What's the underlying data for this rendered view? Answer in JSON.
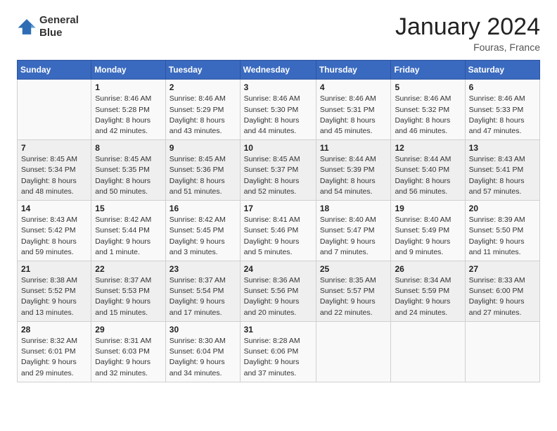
{
  "header": {
    "logo_line1": "General",
    "logo_line2": "Blue",
    "title": "January 2024",
    "subtitle": "Fouras, France"
  },
  "weekdays": [
    "Sunday",
    "Monday",
    "Tuesday",
    "Wednesday",
    "Thursday",
    "Friday",
    "Saturday"
  ],
  "weeks": [
    [
      {
        "num": "",
        "detail": ""
      },
      {
        "num": "1",
        "detail": "Sunrise: 8:46 AM\nSunset: 5:28 PM\nDaylight: 8 hours\nand 42 minutes."
      },
      {
        "num": "2",
        "detail": "Sunrise: 8:46 AM\nSunset: 5:29 PM\nDaylight: 8 hours\nand 43 minutes."
      },
      {
        "num": "3",
        "detail": "Sunrise: 8:46 AM\nSunset: 5:30 PM\nDaylight: 8 hours\nand 44 minutes."
      },
      {
        "num": "4",
        "detail": "Sunrise: 8:46 AM\nSunset: 5:31 PM\nDaylight: 8 hours\nand 45 minutes."
      },
      {
        "num": "5",
        "detail": "Sunrise: 8:46 AM\nSunset: 5:32 PM\nDaylight: 8 hours\nand 46 minutes."
      },
      {
        "num": "6",
        "detail": "Sunrise: 8:46 AM\nSunset: 5:33 PM\nDaylight: 8 hours\nand 47 minutes."
      }
    ],
    [
      {
        "num": "7",
        "detail": "Sunrise: 8:45 AM\nSunset: 5:34 PM\nDaylight: 8 hours\nand 48 minutes."
      },
      {
        "num": "8",
        "detail": "Sunrise: 8:45 AM\nSunset: 5:35 PM\nDaylight: 8 hours\nand 50 minutes."
      },
      {
        "num": "9",
        "detail": "Sunrise: 8:45 AM\nSunset: 5:36 PM\nDaylight: 8 hours\nand 51 minutes."
      },
      {
        "num": "10",
        "detail": "Sunrise: 8:45 AM\nSunset: 5:37 PM\nDaylight: 8 hours\nand 52 minutes."
      },
      {
        "num": "11",
        "detail": "Sunrise: 8:44 AM\nSunset: 5:39 PM\nDaylight: 8 hours\nand 54 minutes."
      },
      {
        "num": "12",
        "detail": "Sunrise: 8:44 AM\nSunset: 5:40 PM\nDaylight: 8 hours\nand 56 minutes."
      },
      {
        "num": "13",
        "detail": "Sunrise: 8:43 AM\nSunset: 5:41 PM\nDaylight: 8 hours\nand 57 minutes."
      }
    ],
    [
      {
        "num": "14",
        "detail": "Sunrise: 8:43 AM\nSunset: 5:42 PM\nDaylight: 8 hours\nand 59 minutes."
      },
      {
        "num": "15",
        "detail": "Sunrise: 8:42 AM\nSunset: 5:44 PM\nDaylight: 9 hours\nand 1 minute."
      },
      {
        "num": "16",
        "detail": "Sunrise: 8:42 AM\nSunset: 5:45 PM\nDaylight: 9 hours\nand 3 minutes."
      },
      {
        "num": "17",
        "detail": "Sunrise: 8:41 AM\nSunset: 5:46 PM\nDaylight: 9 hours\nand 5 minutes."
      },
      {
        "num": "18",
        "detail": "Sunrise: 8:40 AM\nSunset: 5:47 PM\nDaylight: 9 hours\nand 7 minutes."
      },
      {
        "num": "19",
        "detail": "Sunrise: 8:40 AM\nSunset: 5:49 PM\nDaylight: 9 hours\nand 9 minutes."
      },
      {
        "num": "20",
        "detail": "Sunrise: 8:39 AM\nSunset: 5:50 PM\nDaylight: 9 hours\nand 11 minutes."
      }
    ],
    [
      {
        "num": "21",
        "detail": "Sunrise: 8:38 AM\nSunset: 5:52 PM\nDaylight: 9 hours\nand 13 minutes."
      },
      {
        "num": "22",
        "detail": "Sunrise: 8:37 AM\nSunset: 5:53 PM\nDaylight: 9 hours\nand 15 minutes."
      },
      {
        "num": "23",
        "detail": "Sunrise: 8:37 AM\nSunset: 5:54 PM\nDaylight: 9 hours\nand 17 minutes."
      },
      {
        "num": "24",
        "detail": "Sunrise: 8:36 AM\nSunset: 5:56 PM\nDaylight: 9 hours\nand 20 minutes."
      },
      {
        "num": "25",
        "detail": "Sunrise: 8:35 AM\nSunset: 5:57 PM\nDaylight: 9 hours\nand 22 minutes."
      },
      {
        "num": "26",
        "detail": "Sunrise: 8:34 AM\nSunset: 5:59 PM\nDaylight: 9 hours\nand 24 minutes."
      },
      {
        "num": "27",
        "detail": "Sunrise: 8:33 AM\nSunset: 6:00 PM\nDaylight: 9 hours\nand 27 minutes."
      }
    ],
    [
      {
        "num": "28",
        "detail": "Sunrise: 8:32 AM\nSunset: 6:01 PM\nDaylight: 9 hours\nand 29 minutes."
      },
      {
        "num": "29",
        "detail": "Sunrise: 8:31 AM\nSunset: 6:03 PM\nDaylight: 9 hours\nand 32 minutes."
      },
      {
        "num": "30",
        "detail": "Sunrise: 8:30 AM\nSunset: 6:04 PM\nDaylight: 9 hours\nand 34 minutes."
      },
      {
        "num": "31",
        "detail": "Sunrise: 8:28 AM\nSunset: 6:06 PM\nDaylight: 9 hours\nand 37 minutes."
      },
      {
        "num": "",
        "detail": ""
      },
      {
        "num": "",
        "detail": ""
      },
      {
        "num": "",
        "detail": ""
      }
    ]
  ]
}
